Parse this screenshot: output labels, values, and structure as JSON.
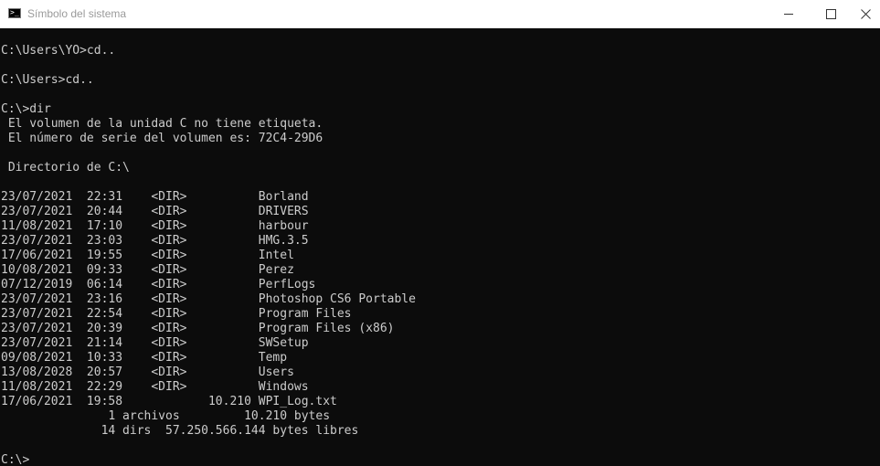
{
  "window": {
    "title": "Símbolo del sistema",
    "icon": "cmd-icon",
    "icon_glyph": ">_",
    "controls": [
      "minimize-icon",
      "maximize-icon",
      "close-icon"
    ]
  },
  "colors": {
    "console_background": "#0c0c0c",
    "console_text": "#cccccc",
    "titlebar_background": "#ffffff",
    "title_text": "#9a9a9a"
  },
  "console": {
    "lines": [
      "",
      "C:\\Users\\YO>cd..",
      "",
      "C:\\Users>cd..",
      "",
      "C:\\>dir",
      " El volumen de la unidad C no tiene etiqueta.",
      " El número de serie del volumen es: 72C4-29D6",
      "",
      " Directorio de C:\\",
      "",
      "23/07/2021  22:31    <DIR>          Borland",
      "23/07/2021  20:44    <DIR>          DRIVERS",
      "11/08/2021  17:10    <DIR>          harbour",
      "23/07/2021  23:03    <DIR>          HMG.3.5",
      "17/06/2021  19:55    <DIR>          Intel",
      "10/08/2021  09:33    <DIR>          Perez",
      "07/12/2019  06:14    <DIR>          PerfLogs",
      "23/07/2021  23:16    <DIR>          Photoshop CS6 Portable",
      "23/07/2021  22:54    <DIR>          Program Files",
      "23/07/2021  20:39    <DIR>          Program Files (x86)",
      "23/07/2021  21:14    <DIR>          SWSetup",
      "09/08/2021  10:33    <DIR>          Temp",
      "13/08/2028  20:57    <DIR>          Users",
      "11/08/2021  22:29    <DIR>          Windows",
      "17/06/2021  19:58            10.210 WPI_Log.txt",
      "               1 archivos         10.210 bytes",
      "              14 dirs  57.250.566.144 bytes libres",
      "",
      "C:\\>"
    ]
  }
}
